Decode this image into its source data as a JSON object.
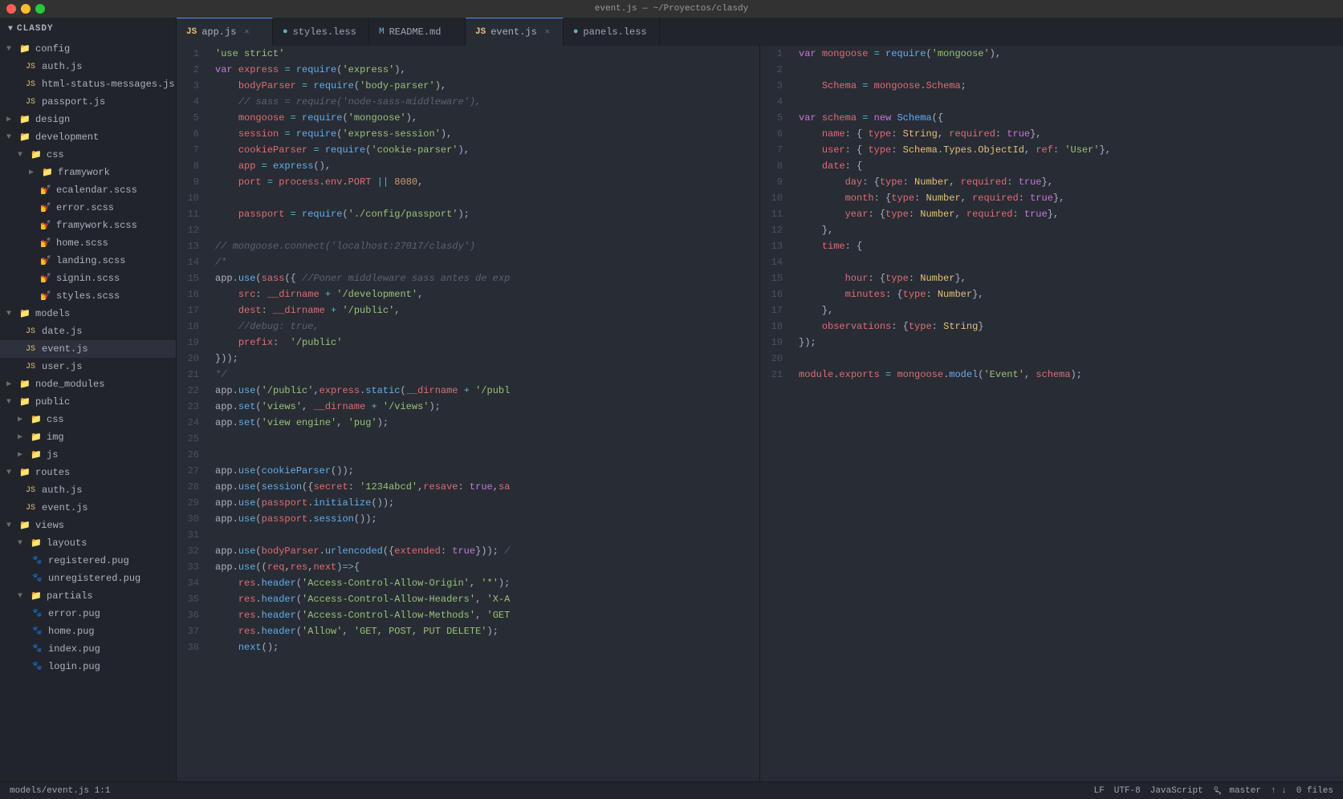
{
  "titlebar": {
    "title": "event.js — ~/Proyectos/clasdy"
  },
  "tabs_left": [
    {
      "id": "app-js",
      "label": "app.js",
      "icon": "js",
      "active": true,
      "closable": true
    },
    {
      "id": "styles-less",
      "label": "styles.less",
      "icon": "css",
      "active": false,
      "closable": false
    },
    {
      "id": "readme-md",
      "label": "README.md",
      "icon": "md",
      "active": false,
      "closable": false
    },
    {
      "id": "event-js",
      "label": "event.js",
      "icon": "js",
      "active": false,
      "closable": true
    },
    {
      "id": "panels-less",
      "label": "panels.less",
      "icon": "css",
      "active": false,
      "closable": false
    }
  ],
  "sidebar": {
    "title": "CLASDY",
    "tree": [
      {
        "level": 0,
        "type": "folder",
        "label": "config",
        "open": true
      },
      {
        "level": 1,
        "type": "file-js",
        "label": "auth.js"
      },
      {
        "level": 1,
        "type": "file-js",
        "label": "html-status-messages.js"
      },
      {
        "level": 1,
        "type": "file-js",
        "label": "passport.js"
      },
      {
        "level": 0,
        "type": "folder",
        "label": "design",
        "open": false
      },
      {
        "level": 0,
        "type": "folder",
        "label": "development",
        "open": true
      },
      {
        "level": 1,
        "type": "folder",
        "label": "css",
        "open": true
      },
      {
        "level": 2,
        "type": "folder",
        "label": "framywork",
        "open": false
      },
      {
        "level": 2,
        "type": "file-scss",
        "label": "ecalendar.scss"
      },
      {
        "level": 2,
        "type": "file-scss",
        "label": "error.scss"
      },
      {
        "level": 2,
        "type": "file-scss",
        "label": "framywork.scss"
      },
      {
        "level": 2,
        "type": "file-scss",
        "label": "home.scss"
      },
      {
        "level": 2,
        "type": "file-scss",
        "label": "landing.scss"
      },
      {
        "level": 2,
        "type": "file-scss",
        "label": "signin.scss"
      },
      {
        "level": 2,
        "type": "file-scss",
        "label": "styles.scss"
      },
      {
        "level": 0,
        "type": "folder",
        "label": "models",
        "open": true
      },
      {
        "level": 1,
        "type": "file-js",
        "label": "date.js"
      },
      {
        "level": 1,
        "type": "file-js",
        "label": "event.js",
        "active": true
      },
      {
        "level": 1,
        "type": "file-js",
        "label": "user.js"
      },
      {
        "level": 0,
        "type": "folder",
        "label": "node_modules",
        "open": false
      },
      {
        "level": 0,
        "type": "folder",
        "label": "public",
        "open": true
      },
      {
        "level": 1,
        "type": "folder",
        "label": "css",
        "open": false
      },
      {
        "level": 1,
        "type": "folder",
        "label": "img",
        "open": false
      },
      {
        "level": 1,
        "type": "folder",
        "label": "js",
        "open": false
      },
      {
        "level": 0,
        "type": "folder",
        "label": "routes",
        "open": true
      },
      {
        "level": 1,
        "type": "file-js",
        "label": "auth.js"
      },
      {
        "level": 1,
        "type": "file-js",
        "label": "event.js"
      },
      {
        "level": 0,
        "type": "folder",
        "label": "views",
        "open": true
      },
      {
        "level": 1,
        "type": "folder",
        "label": "layouts",
        "open": true
      },
      {
        "level": 2,
        "type": "file-pug",
        "label": "registered.pug"
      },
      {
        "level": 2,
        "type": "file-pug",
        "label": "unregistered.pug"
      },
      {
        "level": 1,
        "type": "folder",
        "label": "partials",
        "open": true
      },
      {
        "level": 2,
        "type": "file-pug",
        "label": "error.pug"
      },
      {
        "level": 2,
        "type": "file-pug",
        "label": "home.pug"
      },
      {
        "level": 2,
        "type": "file-pug",
        "label": "index.pug"
      },
      {
        "level": 2,
        "type": "file-pug",
        "label": "login.pug"
      }
    ]
  },
  "editor_left": {
    "filename": "app.js",
    "lines": [
      {
        "n": 1,
        "code": "'use strict'"
      },
      {
        "n": 2,
        "code": "var express = require('express'),"
      },
      {
        "n": 3,
        "code": "    bodyParser = require('body-parser'),"
      },
      {
        "n": 4,
        "code": "    // sass = require('node-sass-middleware'),"
      },
      {
        "n": 5,
        "code": "    mongoose = require('mongoose'),"
      },
      {
        "n": 6,
        "code": "    session = require('express-session'),"
      },
      {
        "n": 7,
        "code": "    cookieParser = require('cookie-parser'),"
      },
      {
        "n": 8,
        "code": "    app = express(),"
      },
      {
        "n": 9,
        "code": "    port = process.env.PORT || 8080,"
      },
      {
        "n": 10,
        "code": ""
      },
      {
        "n": 11,
        "code": "    passport = require('./config/passport');"
      },
      {
        "n": 12,
        "code": ""
      },
      {
        "n": 13,
        "code": "// mongoose.connect('localhost:27017/clasdy')"
      },
      {
        "n": 14,
        "code": "/*"
      },
      {
        "n": 15,
        "code": "app.use(sass({ //Poner middleware sass antes de exp"
      },
      {
        "n": 16,
        "code": "    src: __dirname + '/development',"
      },
      {
        "n": 17,
        "code": "    dest: __dirname + '/public',"
      },
      {
        "n": 18,
        "code": "    //debug: true,"
      },
      {
        "n": 19,
        "code": "    prefix:  '/public'"
      },
      {
        "n": 20,
        "code": "}));"
      },
      {
        "n": 21,
        "code": "*/"
      },
      {
        "n": 22,
        "code": "app.use('/public',express.static(__dirname + '/publ"
      },
      {
        "n": 23,
        "code": "app.set('views', __dirname + '/views');"
      },
      {
        "n": 24,
        "code": "app.set('view engine', 'pug');"
      },
      {
        "n": 25,
        "code": ""
      },
      {
        "n": 26,
        "code": ""
      },
      {
        "n": 27,
        "code": "app.use(cookieParser());"
      },
      {
        "n": 28,
        "code": "app.use(session({secret: '1234abcd',resave: true,sa"
      },
      {
        "n": 29,
        "code": "app.use(passport.initialize());"
      },
      {
        "n": 30,
        "code": "app.use(passport.session());"
      },
      {
        "n": 31,
        "code": ""
      },
      {
        "n": 32,
        "code": "app.use(bodyParser.urlencoded({extended: true})); /"
      },
      {
        "n": 33,
        "code": "app.use((req,res,next)=>{"
      },
      {
        "n": 34,
        "code": "    res.header('Access-Control-Allow-Origin', '*');"
      },
      {
        "n": 35,
        "code": "    res.header('Access-Control-Allow-Headers', 'X-A"
      },
      {
        "n": 36,
        "code": "    res.header('Access-Control-Allow-Methods', 'GET"
      },
      {
        "n": 37,
        "code": "    res.header('Allow', 'GET, POST, PUT DELETE');"
      },
      {
        "n": 38,
        "code": "    next();"
      }
    ]
  },
  "editor_right": {
    "filename": "event.js",
    "lines": [
      {
        "n": 1,
        "code": "var mongoose = require('mongoose'),"
      },
      {
        "n": 2,
        "code": ""
      },
      {
        "n": 3,
        "code": "    Schema = mongoose.Schema;"
      },
      {
        "n": 4,
        "code": ""
      },
      {
        "n": 5,
        "code": "var schema = new Schema({"
      },
      {
        "n": 6,
        "code": "    name: { type: String, required: true},"
      },
      {
        "n": 7,
        "code": "    user: { type: Schema.Types.ObjectId, ref: 'User'},"
      },
      {
        "n": 8,
        "code": "    date: {"
      },
      {
        "n": 9,
        "code": "        day: {type: Number, required: true},"
      },
      {
        "n": 10,
        "code": "        month: {type: Number, required: true},"
      },
      {
        "n": 11,
        "code": "        year: {type: Number, required: true},"
      },
      {
        "n": 12,
        "code": "    },"
      },
      {
        "n": 13,
        "code": "    time: {"
      },
      {
        "n": 14,
        "code": ""
      },
      {
        "n": 15,
        "code": "        hour: {type: Number},"
      },
      {
        "n": 16,
        "code": "        minutes: {type: Number},"
      },
      {
        "n": 17,
        "code": "    },"
      },
      {
        "n": 18,
        "code": "    observations: {type: String}"
      },
      {
        "n": 19,
        "code": "});"
      },
      {
        "n": 20,
        "code": ""
      },
      {
        "n": 21,
        "code": "module.exports = mongoose.model('Event', schema);"
      }
    ]
  },
  "statusbar": {
    "left": "models/event.js  1:1",
    "encoding": "LF",
    "charset": "UTF-8",
    "language": "JavaScript",
    "branch": "master",
    "files": "0 files"
  }
}
